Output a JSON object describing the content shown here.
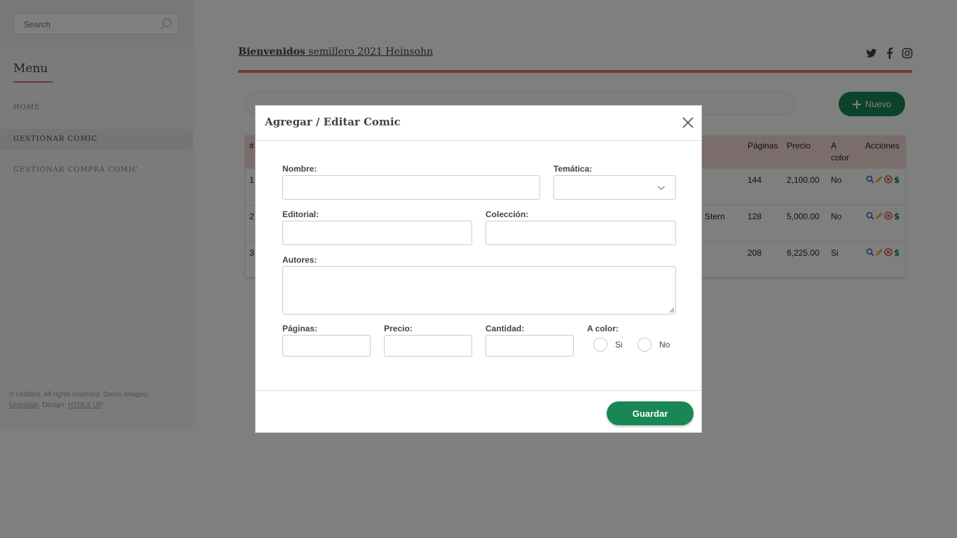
{
  "sidebar": {
    "search_placeholder": "Search",
    "menu_heading": "Menu",
    "items": [
      {
        "label": "HOME"
      },
      {
        "label": "GESTIONAR COMIC"
      },
      {
        "label": "GESTIONAR COMPRA COMIC"
      }
    ],
    "footer": {
      "line1": "© Untitled. All rights reserved. Demo Images: ",
      "unsplash": "Unsplash",
      "design": ". Design: ",
      "html5up": "HTML5 UP",
      "end": "."
    }
  },
  "header": {
    "title_bold": "Bienvenidos",
    "title_rest": " semillero 2021 Heinsohn",
    "social_icons": [
      "twitter-icon",
      "facebook-icon",
      "instagram-icon"
    ]
  },
  "toolbar": {
    "new_label": "Nuevo"
  },
  "table": {
    "headers": {
      "num": "#",
      "paginas": "Páginas",
      "precio": "Precio",
      "a_color": "A color",
      "acciones": "Acciones"
    },
    "rows": [
      {
        "num": "1",
        "extra": "",
        "paginas": "144",
        "precio": "2,100.00",
        "a_color": "No"
      },
      {
        "num": "2",
        "extra": "Stern",
        "paginas": "128",
        "precio": "5,000.00",
        "a_color": "No"
      },
      {
        "num": "3",
        "extra": "",
        "paginas": "208",
        "precio": "6,225.00",
        "a_color": "Si"
      }
    ]
  },
  "modal": {
    "title": "Agregar / Editar Comic",
    "labels": {
      "nombre": "Nombre:",
      "tematica": "Temática:",
      "editorial": "Editorial:",
      "coleccion": "Colección:",
      "autores": "Autores:",
      "paginas": "Páginas:",
      "precio": "Precio:",
      "cantidad": "Cantidad:",
      "a_color": "A color:"
    },
    "values": {
      "nombre": "",
      "tematica": "",
      "editorial": "",
      "coleccion": "",
      "autores": "",
      "paginas": "",
      "precio": "",
      "cantidad": ""
    },
    "radio": {
      "si": "Si",
      "no": "No"
    },
    "save_label": "Guardar"
  },
  "colors": {
    "accent": "#f56a6a",
    "primary": "#198754",
    "table_header": "#f9dada"
  }
}
